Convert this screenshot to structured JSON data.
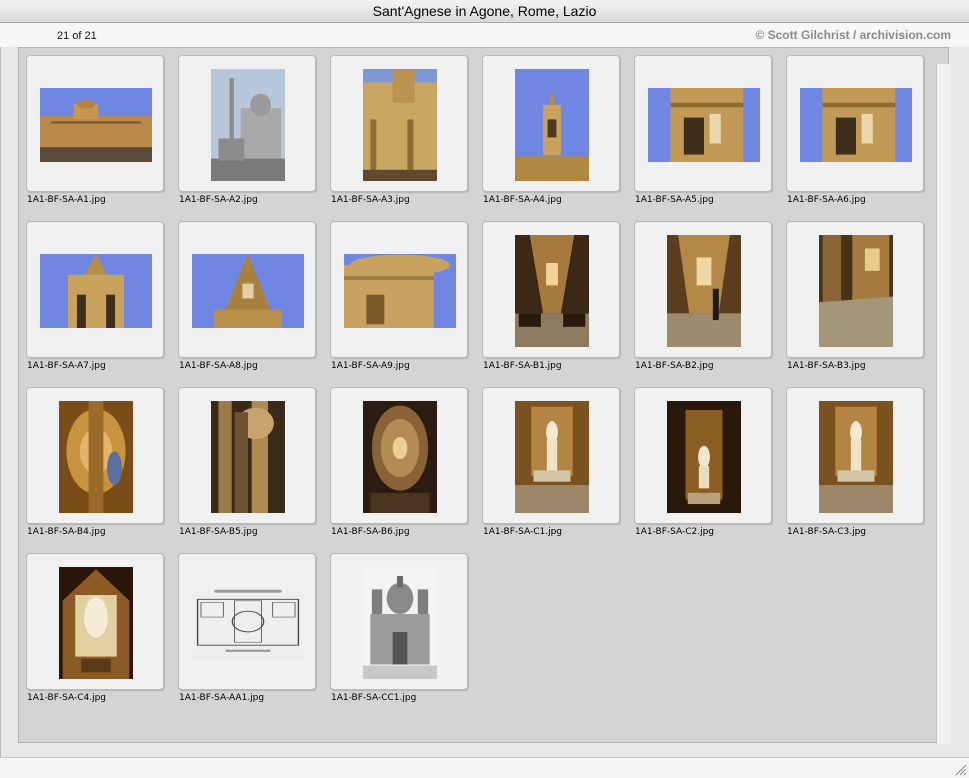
{
  "window": {
    "title": "Sant'Agnese in Agone, Rome, Lazio"
  },
  "header": {
    "count": "21 of 21",
    "credit": "© Scott Gilchrist / archivision.com"
  },
  "thumbnails": [
    {
      "filename": "1A1-BF-SA-A1.jpg",
      "orientation": "landscape",
      "scene": "piazza"
    },
    {
      "filename": "1A1-BF-SA-A2.jpg",
      "orientation": "portrait",
      "scene": "facade-obelisk"
    },
    {
      "filename": "1A1-BF-SA-A3.jpg",
      "orientation": "portrait",
      "scene": "facade-bell-tower"
    },
    {
      "filename": "1A1-BF-SA-A4.jpg",
      "orientation": "portrait",
      "scene": "bell-tower-sky"
    },
    {
      "filename": "1A1-BF-SA-A5.jpg",
      "orientation": "landscape",
      "scene": "tower-detail"
    },
    {
      "filename": "1A1-BF-SA-A6.jpg",
      "orientation": "landscape",
      "scene": "tower-detail"
    },
    {
      "filename": "1A1-BF-SA-A7.jpg",
      "orientation": "landscape",
      "scene": "tower-top-sky"
    },
    {
      "filename": "1A1-BF-SA-A8.jpg",
      "orientation": "landscape",
      "scene": "spire-sky"
    },
    {
      "filename": "1A1-BF-SA-A9.jpg",
      "orientation": "landscape",
      "scene": "dome-drum"
    },
    {
      "filename": "1A1-BF-SA-B1.jpg",
      "orientation": "portrait",
      "scene": "nave-interior"
    },
    {
      "filename": "1A1-BF-SA-B2.jpg",
      "orientation": "portrait",
      "scene": "interior-visitor"
    },
    {
      "filename": "1A1-BF-SA-B3.jpg",
      "orientation": "portrait",
      "scene": "interior-floor"
    },
    {
      "filename": "1A1-BF-SA-B4.jpg",
      "orientation": "portrait",
      "scene": "ceiling-gold"
    },
    {
      "filename": "1A1-BF-SA-B5.jpg",
      "orientation": "portrait",
      "scene": "pilasters-upward"
    },
    {
      "filename": "1A1-BF-SA-B6.jpg",
      "orientation": "portrait",
      "scene": "dome-interior"
    },
    {
      "filename": "1A1-BF-SA-C1.jpg",
      "orientation": "portrait",
      "scene": "altar-statue"
    },
    {
      "filename": "1A1-BF-SA-C2.jpg",
      "orientation": "portrait",
      "scene": "altar-statue-dark"
    },
    {
      "filename": "1A1-BF-SA-C3.jpg",
      "orientation": "portrait",
      "scene": "altar-statue"
    },
    {
      "filename": "1A1-BF-SA-C4.jpg",
      "orientation": "portrait",
      "scene": "relief-altar"
    },
    {
      "filename": "1A1-BF-SA-AA1.jpg",
      "orientation": "landscape",
      "scene": "floor-plan"
    },
    {
      "filename": "1A1-BF-SA-CC1.jpg",
      "orientation": "portrait",
      "scene": "engraving-facade"
    }
  ],
  "colors": {
    "sky": "#6f86e2",
    "stone": "#c9a35c",
    "interior": "#6b4a22",
    "panel": "#d4d4d4"
  },
  "icons": {
    "resize": "resize-grip-icon"
  }
}
